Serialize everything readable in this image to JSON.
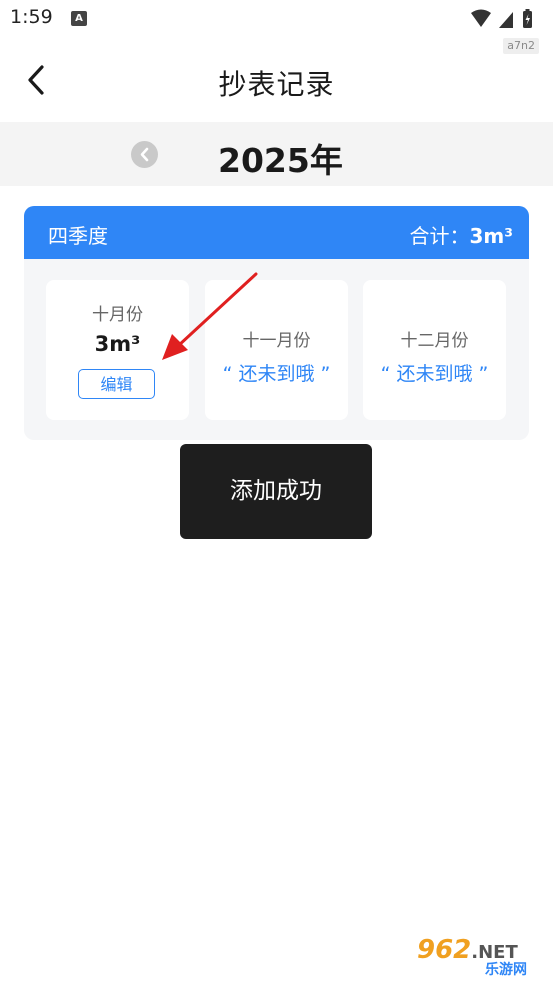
{
  "status_bar": {
    "time": "1:59",
    "notification_icon_letter": "A",
    "icons": [
      "wifi-icon",
      "cell-signal-icon",
      "battery-icon"
    ],
    "top_watermark": "a7n2"
  },
  "nav": {
    "back_icon": "chevron-left-icon",
    "title": "抄表记录"
  },
  "year_selector": {
    "prev_icon": "chevron-left-icon",
    "year": "2025年"
  },
  "quarter": {
    "name": "四季度",
    "total_label": "合计：",
    "total_value": "3m³",
    "months": [
      {
        "label": "十月份",
        "value": "3m³",
        "action": "编辑"
      },
      {
        "label": "十一月份",
        "status": "“ 还未到哦 ”"
      },
      {
        "label": "十二月份",
        "status": "“ 还未到哦 ”"
      }
    ]
  },
  "toast": {
    "message": "添加成功"
  },
  "watermark": {
    "brand": "962",
    "suffix": ".NET",
    "sub": "乐游网"
  },
  "colors": {
    "accent": "#2f86f6",
    "annotation_arrow": "#e02020",
    "toast_bg": "#1e1e1e",
    "year_bar_bg": "#f4f4f4"
  }
}
